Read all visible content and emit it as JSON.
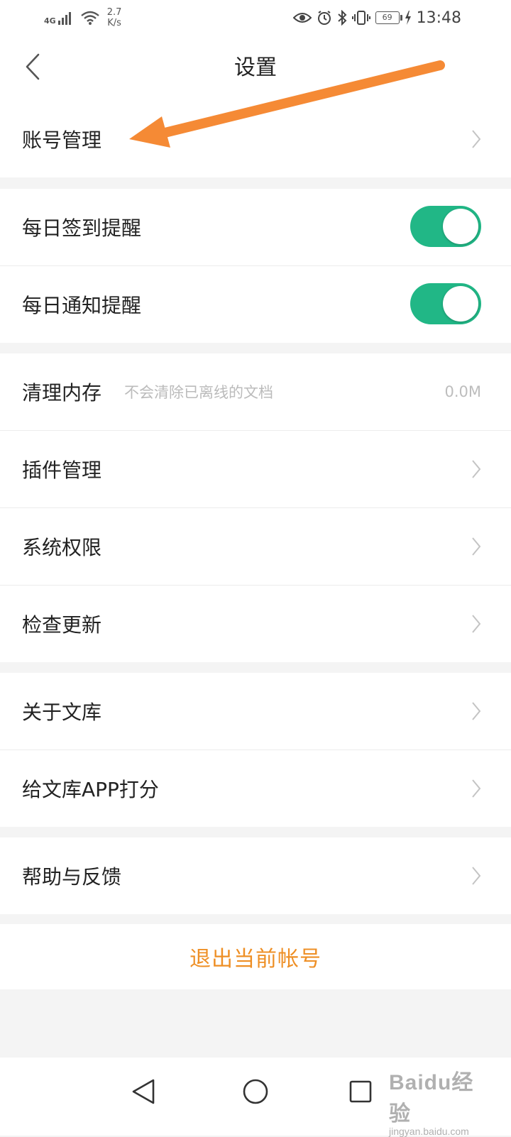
{
  "status_bar": {
    "network": "4G",
    "speed_value": "2.7",
    "speed_unit": "K/s",
    "battery": "69",
    "time": "13:48"
  },
  "header": {
    "title": "设置"
  },
  "groups": [
    {
      "rows": [
        {
          "label": "账号管理",
          "type": "chevron"
        }
      ]
    },
    {
      "rows": [
        {
          "label": "每日签到提醒",
          "type": "toggle",
          "enabled": true
        },
        {
          "label": "每日通知提醒",
          "type": "toggle",
          "enabled": true
        }
      ]
    },
    {
      "rows": [
        {
          "label": "清理内存",
          "subtitle": "不会清除已离线的文档",
          "value": "0.0M",
          "type": "value"
        },
        {
          "label": "插件管理",
          "type": "chevron"
        },
        {
          "label": "系统权限",
          "type": "chevron"
        },
        {
          "label": "检查更新",
          "type": "chevron"
        }
      ]
    },
    {
      "rows": [
        {
          "label": "关于文库",
          "type": "chevron"
        },
        {
          "label": "给文库APP打分",
          "type": "chevron"
        }
      ]
    },
    {
      "rows": [
        {
          "label": "帮助与反馈",
          "type": "chevron"
        }
      ]
    }
  ],
  "logout": {
    "label": "退出当前帐号"
  },
  "watermark": {
    "brand": "Baidu经验",
    "sub": "jingyan.baidu.com"
  },
  "colors": {
    "toggle_on": "#21b786",
    "logout_text": "#ee8f25",
    "annotation_arrow": "#f58a35"
  },
  "icons": {
    "back": "chevron-left-icon",
    "row_chevron": "chevron-right-icon",
    "nav_back": "triangle-back-icon",
    "nav_home": "circle-home-icon",
    "nav_recent": "square-recent-icon"
  }
}
